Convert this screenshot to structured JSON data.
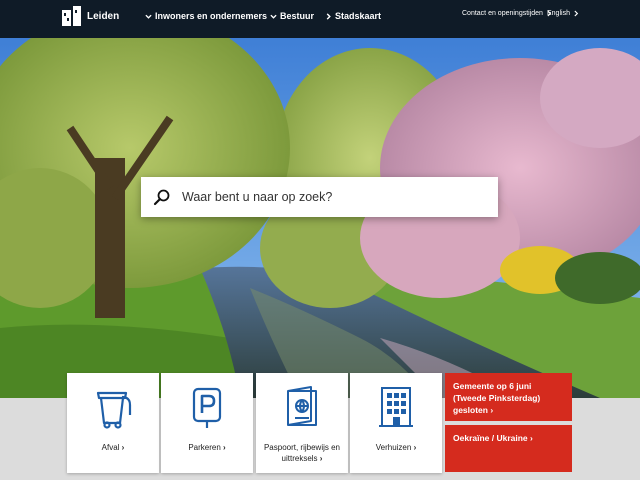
{
  "header": {
    "logo_text": "Leiden",
    "nav": [
      {
        "label": "Inwoners en ondernemers"
      },
      {
        "label": "Bestuur"
      },
      {
        "label": "Stadskaart"
      }
    ],
    "utility": [
      {
        "label": "Contact en openingstijden"
      },
      {
        "label": "English"
      }
    ]
  },
  "search": {
    "placeholder": "Waar bent u naar op zoek?"
  },
  "tiles": [
    {
      "label": "Afval",
      "icon": "waste-bin-icon"
    },
    {
      "label": "Parkeren",
      "icon": "parking-icon"
    },
    {
      "label": "Paspoort, rijbewijs en uittreksels",
      "icon": "passport-icon"
    },
    {
      "label": "Verhuizen",
      "icon": "building-icon"
    }
  ],
  "alerts": [
    {
      "label": "Gemeente op 6 juni (Tweede Pinksterdag) gesloten"
    },
    {
      "label": "Oekraïne / Ukraine"
    }
  ],
  "colors": {
    "header_bg": "#0f1b27",
    "icon_blue": "#1f5fa8",
    "alert_red": "#d52b1e"
  }
}
